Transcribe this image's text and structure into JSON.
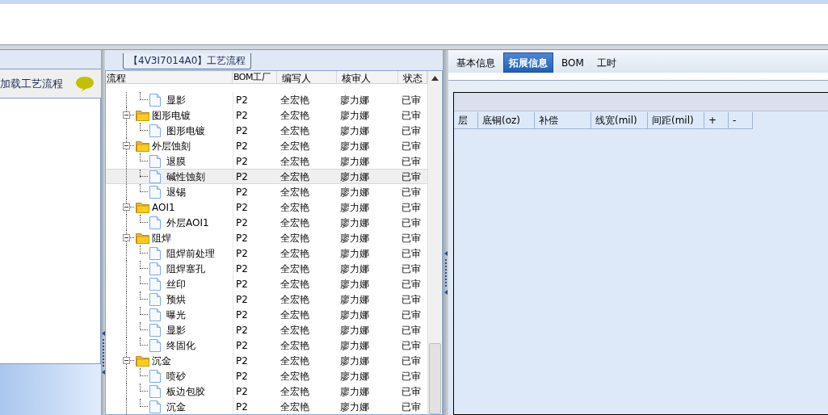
{
  "left_panel": {
    "title": "加载工艺流程"
  },
  "process": {
    "title": "【4V3I7014A0】工艺流程",
    "columns": [
      "流程",
      "BOM工厂",
      "编写人",
      "核审人",
      "状态"
    ],
    "groups": [
      {
        "children": [
          {
            "name": "显影",
            "bom": "P2",
            "writer": "全宏艳",
            "reviewer": "廖力娜",
            "status": "已审",
            "selected": false
          }
        ]
      },
      {
        "name": "图形电镀",
        "bom": "P2",
        "writer": "全宏艳",
        "reviewer": "廖力娜",
        "status": "已审",
        "selected": false,
        "expanded": true,
        "children": [
          {
            "name": "图形电镀",
            "bom": "P2",
            "writer": "全宏艳",
            "reviewer": "廖力娜",
            "status": "已审",
            "selected": false
          }
        ]
      },
      {
        "name": "外层蚀刻",
        "bom": "P2",
        "writer": "全宏艳",
        "reviewer": "廖力娜",
        "status": "已审",
        "selected": false,
        "expanded": true,
        "children": [
          {
            "name": "退膜",
            "bom": "P2",
            "writer": "全宏艳",
            "reviewer": "廖力娜",
            "status": "已审",
            "selected": false
          },
          {
            "name": "碱性蚀刻",
            "bom": "P2",
            "writer": "全宏艳",
            "reviewer": "廖力娜",
            "status": "已审",
            "selected": true
          },
          {
            "name": "退锡",
            "bom": "P2",
            "writer": "全宏艳",
            "reviewer": "廖力娜",
            "status": "已审",
            "selected": false
          }
        ]
      },
      {
        "name": "AOI1",
        "bom": "P2",
        "writer": "全宏艳",
        "reviewer": "廖力娜",
        "status": "已审",
        "selected": false,
        "expanded": true,
        "children": [
          {
            "name": "外层AOI1",
            "bom": "P2",
            "writer": "全宏艳",
            "reviewer": "廖力娜",
            "status": "已审",
            "selected": false
          }
        ]
      },
      {
        "name": "阻焊",
        "bom": "P2",
        "writer": "全宏艳",
        "reviewer": "廖力娜",
        "status": "已审",
        "selected": false,
        "expanded": true,
        "children": [
          {
            "name": "阻焊前处理",
            "bom": "P2",
            "writer": "全宏艳",
            "reviewer": "廖力娜",
            "status": "已审",
            "selected": false
          },
          {
            "name": "阻焊塞孔",
            "bom": "P2",
            "writer": "全宏艳",
            "reviewer": "廖力娜",
            "status": "已审",
            "selected": false
          },
          {
            "name": "丝印",
            "bom": "P2",
            "writer": "全宏艳",
            "reviewer": "廖力娜",
            "status": "已审",
            "selected": false
          },
          {
            "name": "预烘",
            "bom": "P2",
            "writer": "全宏艳",
            "reviewer": "廖力娜",
            "status": "已审",
            "selected": false
          },
          {
            "name": "曝光",
            "bom": "P2",
            "writer": "全宏艳",
            "reviewer": "廖力娜",
            "status": "已审",
            "selected": false
          },
          {
            "name": "显影",
            "bom": "P2",
            "writer": "全宏艳",
            "reviewer": "廖力娜",
            "status": "已审",
            "selected": false
          },
          {
            "name": "终固化",
            "bom": "P2",
            "writer": "全宏艳",
            "reviewer": "廖力娜",
            "status": "已审",
            "selected": false
          }
        ]
      },
      {
        "name": "沉金",
        "bom": "P2",
        "writer": "全宏艳",
        "reviewer": "廖力娜",
        "status": "已审",
        "selected": false,
        "expanded": true,
        "children": [
          {
            "name": "喷砂",
            "bom": "P2",
            "writer": "全宏艳",
            "reviewer": "廖力娜",
            "status": "已审",
            "selected": false
          },
          {
            "name": "板边包胶",
            "bom": "P2",
            "writer": "全宏艳",
            "reviewer": "廖力娜",
            "status": "已审",
            "selected": false
          },
          {
            "name": "沉金",
            "bom": "P2",
            "writer": "全宏艳",
            "reviewer": "廖力娜",
            "status": "已审",
            "selected": false
          }
        ]
      }
    ]
  },
  "detail": {
    "tabs": [
      {
        "label": "基本信息",
        "selected": false
      },
      {
        "label": "拓展信息",
        "selected": true
      },
      {
        "label": "BOM",
        "selected": false
      },
      {
        "label": "工时",
        "selected": false
      }
    ],
    "layer_table": {
      "columns": [
        "层",
        "底铜(oz)",
        "补偿",
        "线宽(mil)",
        "间距(mil)",
        "+",
        "-"
      ]
    }
  }
}
